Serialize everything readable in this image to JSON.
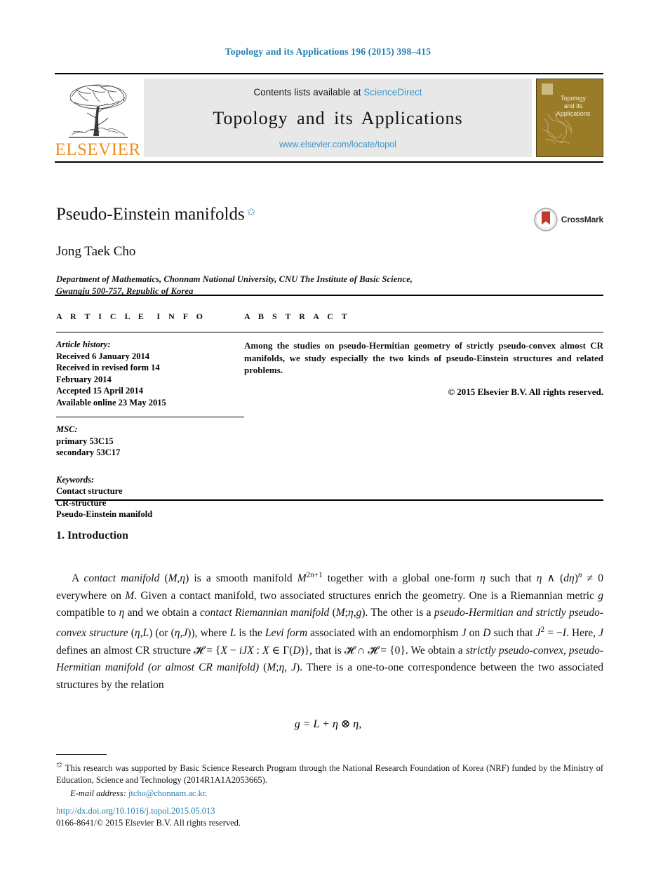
{
  "running_head": "Topology and its Applications 196 (2015) 398–415",
  "masthead": {
    "publisher_name": "ELSEVIER",
    "contents_prefix": "Contents lists available at",
    "contents_link": "ScienceDirect",
    "journal_title": "Topology and its Applications",
    "journal_url": "www.elsevier.com/locate/topol",
    "cover_title_line1": "Topology",
    "cover_title_line2": "and its",
    "cover_title_line3": "Applications"
  },
  "article": {
    "title": "Pseudo-Einstein manifolds",
    "title_footnote_marker": "✩",
    "author": "Jong Taek Cho",
    "affiliation_line1": "Department of Mathematics, Chonnam National University, CNU The Institute of Basic Science,",
    "affiliation_line2": "Gwangju 500-757, Republic of Korea",
    "crossmark_label": "CrossMark"
  },
  "info": {
    "label": "ARTICLE INFO",
    "history_head": "Article history:",
    "history": [
      "Received 6 January 2014",
      "Received in revised form 14",
      "February 2014",
      "Accepted 15 April 2014",
      "Available online 23 May 2015"
    ],
    "msc_head": "MSC:",
    "msc": [
      "primary 53C15",
      "secondary 53C17"
    ],
    "keywords_head": "Keywords:",
    "keywords": [
      "Contact structure",
      "CR-structure",
      "Pseudo-Einstein manifold"
    ]
  },
  "abstract": {
    "label": "ABSTRACT",
    "text": "Among the studies on pseudo-Hermitian geometry of strictly pseudo-convex almost CR manifolds, we study especially the two kinds of pseudo-Einstein structures and related problems.",
    "copyright": "© 2015 Elsevier B.V. All rights reserved."
  },
  "body": {
    "section_heading": "1. Introduction",
    "equation": "g = L + η ⊗ η,"
  },
  "footnotes": {
    "marker": "✩",
    "support_text": "This research was supported by Basic Science Research Program through the National Research Foundation of Korea (NRF) funded by the Ministry of Education, Science and Technology (2014R1A1A2053665).",
    "email_label": "E-mail address:",
    "email_address": "jtcho@chonnam.ac.kr",
    "email_trailing": "."
  },
  "imprint": {
    "doi": "http://dx.doi.org/10.1016/j.topol.2015.05.013",
    "issn_line": "0166-8641/© 2015 Elsevier B.V. All rights reserved."
  },
  "colors": {
    "link": "#1f7fad",
    "science_direct": "#3b95c9",
    "elsevier_orange": "#f08c20",
    "cover_bg": "#9a7b28",
    "masthead_bg": "#e8e8e8"
  }
}
